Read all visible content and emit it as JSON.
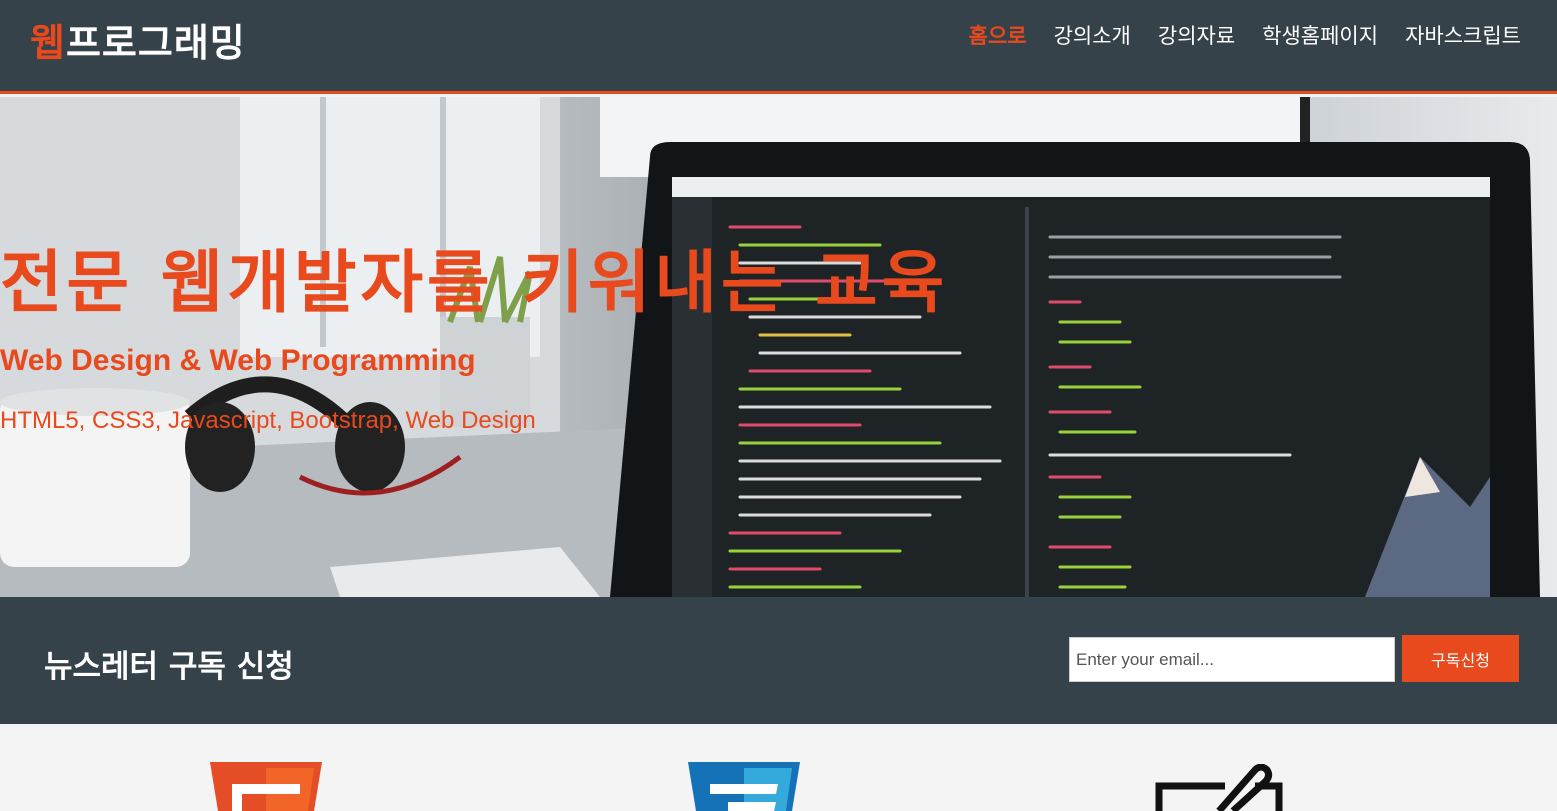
{
  "header": {
    "logo_highlight": "웹",
    "logo_rest": "프로그래밍",
    "nav": [
      {
        "label": "홈으로",
        "active": true
      },
      {
        "label": "강의소개",
        "active": false
      },
      {
        "label": "강의자료",
        "active": false
      },
      {
        "label": "학생홈페이지",
        "active": false
      },
      {
        "label": "자바스크립트",
        "active": false
      }
    ]
  },
  "hero": {
    "title": "전문 웹개발자를 키워내는 교육",
    "subtitle": "Web Design & Web Programming",
    "tags": "HTML5, CSS3, Javascript, Bootstrap, Web Design"
  },
  "newsletter": {
    "title": "뉴스레터 구독 신청",
    "email_placeholder": "Enter your email...",
    "button_label": "구독신청"
  },
  "boxes": {
    "icons": [
      "html5-icon",
      "css3-icon",
      "design-tablet-icon"
    ]
  },
  "colors": {
    "accent": "#e8491d",
    "dark": "#35424a",
    "light": "#f4f4f4"
  }
}
